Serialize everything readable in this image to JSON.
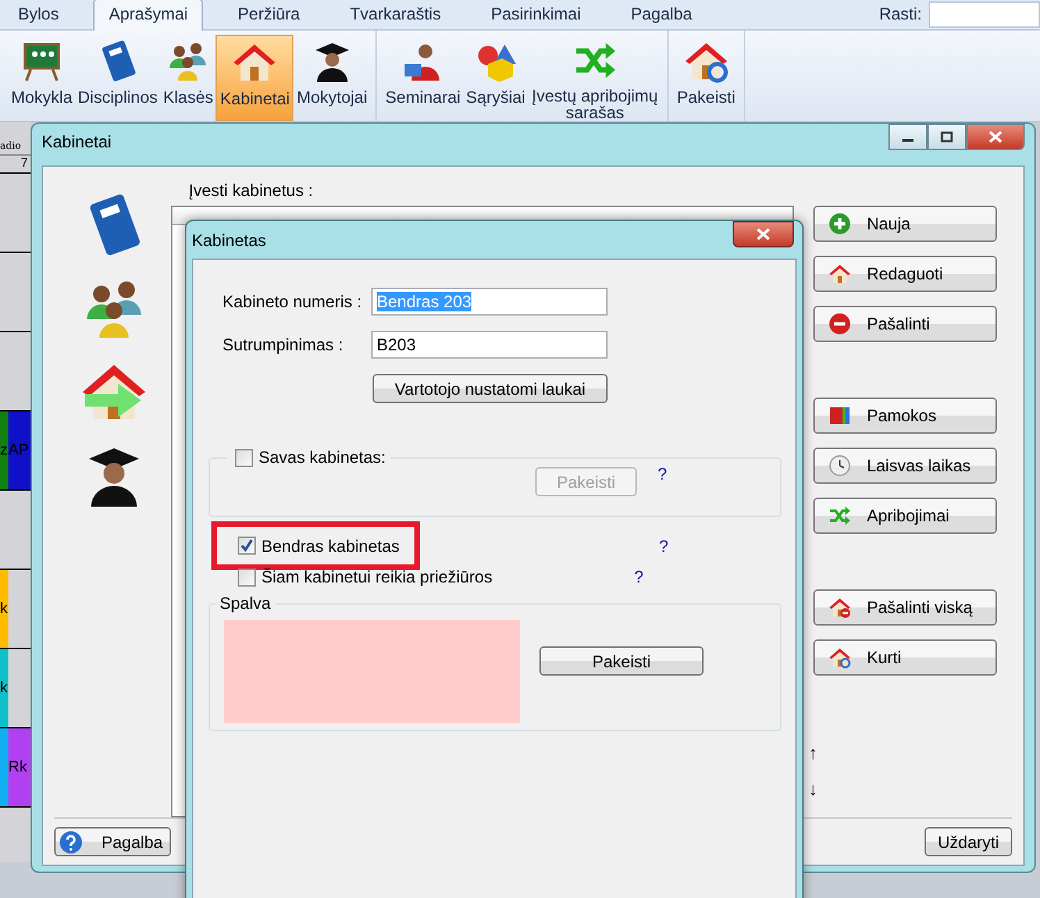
{
  "menu_tabs": [
    {
      "label": "Bylos",
      "selected": false
    },
    {
      "label": "Aprašymai",
      "selected": true
    },
    {
      "label": "Peržiūra",
      "selected": false
    },
    {
      "label": "Tvarkaraštis",
      "selected": false
    },
    {
      "label": "Pasirinkimai",
      "selected": false
    },
    {
      "label": "Pagalba",
      "selected": false
    }
  ],
  "search": {
    "label": "Rasti:"
  },
  "ribbon": {
    "groups": [
      [
        {
          "label": "Mokykla",
          "selected": false
        },
        {
          "label": "Disciplinos",
          "selected": false
        },
        {
          "label": "Klasės",
          "selected": false
        },
        {
          "label": "Kabinetai",
          "selected": true
        },
        {
          "label": "Mokytojai",
          "selected": false
        }
      ],
      [
        {
          "label": "Seminarai",
          "selected": false
        },
        {
          "label": "Sąryšiai",
          "selected": false
        },
        {
          "label": "Įvestų apribojimų sarašas",
          "selected": false
        }
      ],
      [
        {
          "label": "Pakeisti",
          "selected": false
        }
      ]
    ]
  },
  "background_timetable": {
    "header": "adio",
    "column": "7",
    "rows": [
      {},
      {},
      {},
      {
        "left": {
          "text": "z",
          "color": "#118011"
        },
        "right": {
          "text": "AP",
          "color": "#1010c8"
        }
      },
      {},
      {
        "left": {
          "text": "k",
          "color": "#ffbb00"
        }
      },
      {
        "left": {
          "text": "k",
          "color": "#10c0c8"
        }
      },
      {
        "left": {
          "color": "#10b0f0"
        },
        "right": {
          "text": "Rk",
          "color": "#b040f0"
        }
      }
    ]
  },
  "rooms_window": {
    "title": "Kabinetai",
    "list_label": "Įvesti kabinetus :",
    "button_groups": [
      [
        {
          "label": "Nauja"
        },
        {
          "label": "Redaguoti"
        },
        {
          "label": "Pašalinti"
        }
      ],
      [
        {
          "label": "Pamokos"
        },
        {
          "label": "Laisvas laikas"
        },
        {
          "label": "Apribojimai"
        }
      ],
      [
        {
          "label": "Pašalinti viską"
        },
        {
          "label": "Kurti"
        }
      ]
    ],
    "move_buttons": [
      "↑",
      "↓"
    ],
    "help_button": "Pagalba",
    "close_button": "Uždaryti"
  },
  "room_dialog": {
    "title": "Kabinetas",
    "fields": [
      {
        "label": "Kabineto numeris :",
        "value": "Bendras 203",
        "selected": true
      },
      {
        "label": "Sutrumpinimas :",
        "value": "B203",
        "selected": false
      }
    ],
    "custom_fields_button": "Vartotojo nustatomi laukai",
    "own_room": {
      "label": "Savas kabinetas:",
      "checked": false,
      "button": {
        "label": "Pakeisti",
        "disabled": true
      },
      "help": "?"
    },
    "options": [
      {
        "label": "Bendras kabinetas",
        "checked": true,
        "highlighted": true,
        "help": "?"
      },
      {
        "label": "Šiam kabinetui reikia priežiūros",
        "checked": false,
        "highlighted": false,
        "help": "?"
      }
    ],
    "color_group": {
      "title": "Spalva",
      "color": "#ffcccb",
      "button": "Pakeisti"
    }
  }
}
